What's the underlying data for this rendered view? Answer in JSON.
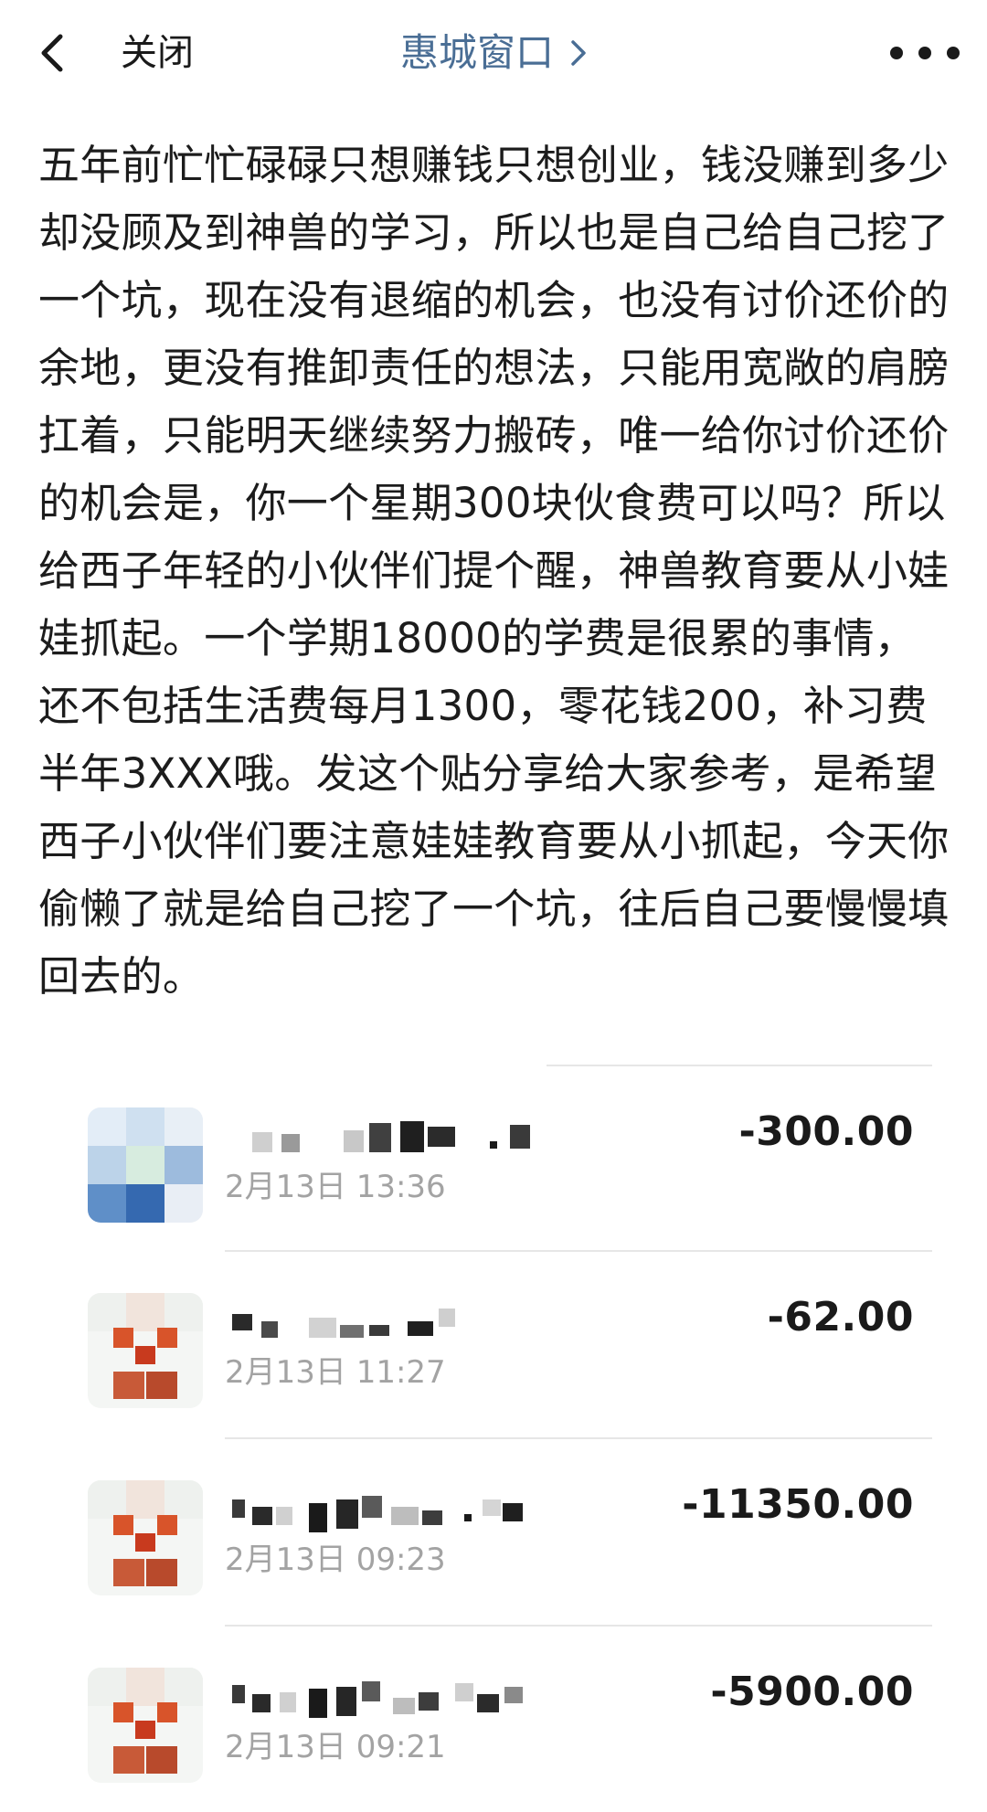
{
  "nav": {
    "back_icon": "chevron-left-icon",
    "close_label": "关闭",
    "title": "惠城窗口",
    "title_arrow_icon": "chevron-right-icon",
    "more_icon": "more-dots-icon"
  },
  "post": {
    "text": "五年前忙忙碌碌只想赚钱只想创业，钱没赚到多少却没顾及到神兽的学习，所以也是自己给自己挖了一个坑，现在没有退缩的机会，也没有讨价还价的余地，更没有推卸责任的想法，只能用宽敞的肩膀扛着，只能明天继续努力搬砖，唯一给你讨价还价的机会是，你一个星期300块伙食费可以吗？所以给西子年轻的小伙伴们提个醒，神兽教育要从小娃娃抓起。一个学期18000的学费是很累的事情，还不包括生活费每月1300，零花钱200，补习费半年3XXX哦。发这个贴分享给大家参考，是希望西子小伙伴们要注意娃娃教育要从小抓起，今天你偷懒了就是给自己挖了一个坑，往后自己要慢慢填回去的。"
  },
  "transactions": [
    {
      "time": "2月13日 13:36",
      "amount": "-300.00",
      "avatar": "blurred-blue-avatar"
    },
    {
      "time": "2月13日 11:27",
      "amount": "-62.00",
      "avatar": "blurred-red-avatar"
    },
    {
      "time": "2月13日 09:23",
      "amount": "-11350.00",
      "avatar": "blurred-red-avatar"
    },
    {
      "time": "2月13日 09:21",
      "amount": "-5900.00",
      "avatar": "blurred-red-avatar"
    }
  ],
  "colors": {
    "title_link": "#4a6e95",
    "time_text": "#a3a3a3",
    "divider": "#e6e6e6"
  }
}
